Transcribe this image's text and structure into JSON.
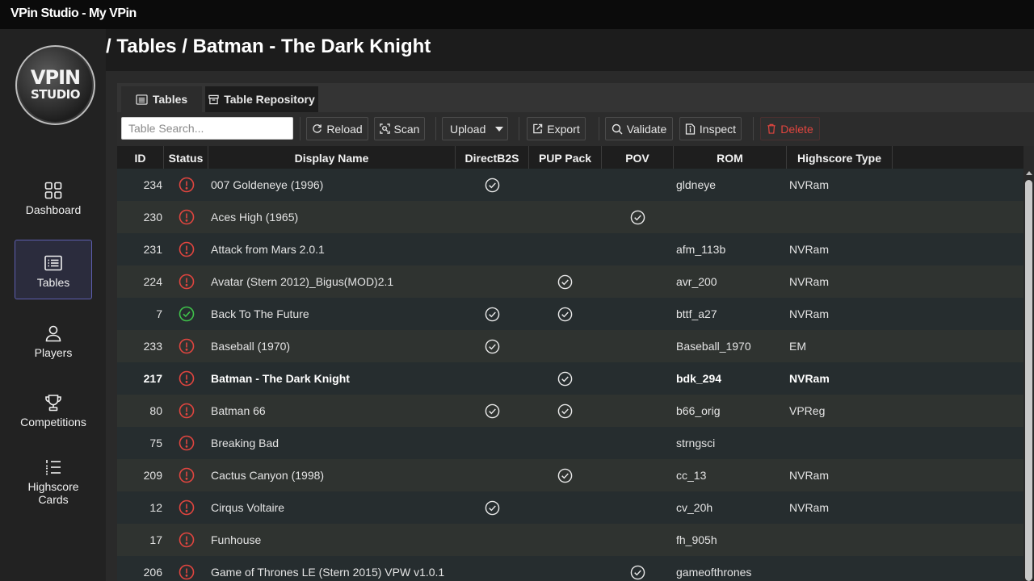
{
  "window": {
    "title": "VPin Studio - My VPin"
  },
  "logo": {
    "line1": "VPIN",
    "line2": "STUDIO"
  },
  "sidebar": {
    "items": [
      {
        "label": "Dashboard",
        "icon": "grid-icon",
        "active": false
      },
      {
        "label": "Tables",
        "icon": "list-icon",
        "active": true
      },
      {
        "label": "Players",
        "icon": "person-icon",
        "active": false
      },
      {
        "label": "Competitions",
        "icon": "trophy-icon",
        "active": false
      },
      {
        "label": "Highscore Cards",
        "icon": "numbered-list-icon",
        "active": false
      }
    ]
  },
  "breadcrumb": "/ Tables / Batman - The Dark Knight",
  "tabs": [
    {
      "label": "Tables",
      "active": true
    },
    {
      "label": "Table Repository",
      "active": false
    }
  ],
  "toolbar": {
    "search_placeholder": "Table Search...",
    "reload": "Reload",
    "scan": "Scan",
    "upload": "Upload",
    "export": "Export",
    "validate": "Validate",
    "inspect": "Inspect",
    "delete": "Delete"
  },
  "table": {
    "headers": {
      "id": "ID",
      "status": "Status",
      "name": "Display Name",
      "b2s": "DirectB2S",
      "pup": "PUP Pack",
      "pov": "POV",
      "rom": "ROM",
      "hs": "Highscore Type"
    },
    "rows": [
      {
        "id": "234",
        "status": "error",
        "name": "007 Goldeneye (1996)",
        "b2s": true,
        "pup": false,
        "pov": false,
        "rom": "gldneye",
        "hs": "NVRam",
        "selected": false
      },
      {
        "id": "230",
        "status": "error",
        "name": "Aces High (1965)",
        "b2s": false,
        "pup": false,
        "pov": true,
        "rom": "",
        "hs": "",
        "selected": false
      },
      {
        "id": "231",
        "status": "error",
        "name": "Attack from Mars 2.0.1",
        "b2s": false,
        "pup": false,
        "pov": false,
        "rom": "afm_113b",
        "hs": "NVRam",
        "selected": false
      },
      {
        "id": "224",
        "status": "error",
        "name": "Avatar (Stern 2012)_Bigus(MOD)2.1",
        "b2s": false,
        "pup": true,
        "pov": false,
        "rom": "avr_200",
        "hs": "NVRam",
        "selected": false
      },
      {
        "id": "7",
        "status": "ok",
        "name": "Back To The Future",
        "b2s": true,
        "pup": true,
        "pov": false,
        "rom": "bttf_a27",
        "hs": "NVRam",
        "selected": false
      },
      {
        "id": "233",
        "status": "error",
        "name": "Baseball (1970)",
        "b2s": true,
        "pup": false,
        "pov": false,
        "rom": "Baseball_1970",
        "hs": "EM",
        "selected": false
      },
      {
        "id": "217",
        "status": "error",
        "name": "Batman - The Dark Knight",
        "b2s": false,
        "pup": true,
        "pov": false,
        "rom": "bdk_294",
        "hs": "NVRam",
        "selected": true
      },
      {
        "id": "80",
        "status": "error",
        "name": "Batman 66",
        "b2s": true,
        "pup": true,
        "pov": false,
        "rom": "b66_orig",
        "hs": "VPReg",
        "selected": false
      },
      {
        "id": "75",
        "status": "error",
        "name": "Breaking Bad",
        "b2s": false,
        "pup": false,
        "pov": false,
        "rom": "strngsci",
        "hs": "",
        "selected": false
      },
      {
        "id": "209",
        "status": "error",
        "name": "Cactus Canyon (1998)",
        "b2s": false,
        "pup": true,
        "pov": false,
        "rom": "cc_13",
        "hs": "NVRam",
        "selected": false
      },
      {
        "id": "12",
        "status": "error",
        "name": "Cirqus Voltaire",
        "b2s": true,
        "pup": false,
        "pov": false,
        "rom": "cv_20h",
        "hs": "NVRam",
        "selected": false
      },
      {
        "id": "17",
        "status": "error",
        "name": "Funhouse",
        "b2s": false,
        "pup": false,
        "pov": false,
        "rom": "fh_905h",
        "hs": "",
        "selected": false
      },
      {
        "id": "206",
        "status": "error",
        "name": "Game of Thrones LE (Stern 2015) VPW v1.0.1",
        "b2s": false,
        "pup": false,
        "pov": true,
        "rom": "gameofthrones",
        "hs": "",
        "selected": false
      }
    ]
  },
  "colors": {
    "error": "#e0453f",
    "ok": "#3fc24a",
    "accent": "#5e5fb0",
    "check": "#e8e8e8"
  }
}
